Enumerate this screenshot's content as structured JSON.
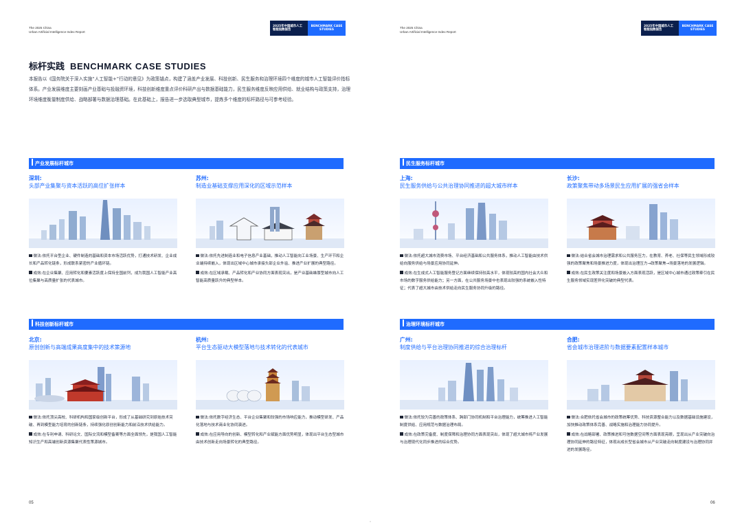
{
  "left_page": {
    "header": {
      "subtitle_line1": "The 2025 China",
      "subtitle_line2": "Urban Artificial Intelligence Index Report",
      "dark_box": "2025年中国城市人工智能指数报告",
      "blue_box": "BENCHMARK CASE STUDIES"
    },
    "title_cn": "标杆实践",
    "title_en": "BENCHMARK CASE STUDIES",
    "intro": "本报告以《国务院关于深入实施“人工智能+”行动的意见》为政策锚点，构建了涵盖产业发展、科技创新、民生服务和治理环境四个维度的城市人工智能评价指标体系。产业发展维度主要刻画产业基础与投融资环境，科技创新维度重点评价科研产出与数据基础能力，民生服务维度反映应用供给、就业结构与政策支持，治理环境维度衡量制度供给、战略部署与数据治理基础。在此基础上，报告进一步选取典型城市，提炼多个维度的标杆路径与可参考经验。",
    "sections": [
      {
        "band": "产业发展标杆城市",
        "cases": [
          {
            "city": "深圳:",
            "slogan": "头部产业集聚与资本活跃的高位扩张样本",
            "method_label": "做法:",
            "method": "依托平台型企业、硬件制造的基础和资本市场活跃优势，打通技术研发、企业成长和产品转化链条，形成联系紧密的产业循环链。",
            "result_label": "成效:",
            "result": "在企业集聚、应用转化和要素活跃度上保持全国前列，成为我国人工智能产业高位集聚与高质量扩张的代表城市。"
          },
          {
            "city": "苏州:",
            "slogan": "制造业基础支撑应用深化的区域示范样本",
            "method_label": "做法:",
            "method": "依托先进制造业和电子信息产业基础，推动人工智能向工业场景、生产环节和企业端持续嵌入，体现出区域中心城市承接头部企业外溢、推进产业扩展的典型路径。",
            "result_label": "成效:",
            "result": "在区域承载、产品转化和产业协同方面表现突出，是产业基础雄厚型城市向人工智能高质量跃升的典型样本。"
          }
        ]
      },
      {
        "band": "科技创新标杆城市",
        "cases": [
          {
            "city": "北京:",
            "slogan": "原创创新与高端成果高度集中的技术策源地",
            "method_label": "做法:",
            "method": "依托顶尖高校、科研机构和国家级创新平台，形成了从基础研究到原始技术突破、再到模型能力培育的创新链条，持续强化原创创新能力和前沿技术供给能力。",
            "result_label": "成效:",
            "result": "在专利申请、科研论文、国际交流和模型备案等方面全面领先，是我国人工智能知识生产和高端创新资源集聚代表性策源城市。"
          },
          {
            "city": "杭州:",
            "slogan": "平台生态驱动大模型落地与技术转化的代表城市",
            "method_label": "做法:",
            "method": "依托数字经济生态、平台企业集聚和较强的市场响应能力，推动模型研发、产品化落地与技术商业化协同演进。",
            "result_label": "成效:",
            "result": "在应用导向的创新、模型转化和产业赋能方面优势明显，体现出平台生态型城市由技术创新走向场景转化的典型路径。"
          }
        ]
      }
    ],
    "page_number": "05"
  },
  "right_page": {
    "header": {
      "subtitle_line1": "The 2025 China",
      "subtitle_line2": "Urban Artificial Intelligence Index Report",
      "dark_box": "2025年中国城市人工智能指数报告",
      "blue_box": "BENCHMARK CASE STUDIES"
    },
    "sections": [
      {
        "band": "民生服务标杆城市",
        "cases": [
          {
            "city": "上海:",
            "slogan": "民生服务供给与公共治理协同推进的超大城市样本",
            "method_label": "做法:",
            "method": "依托超大城市消费市场、平台经济基础和公共服务体系，推动人工智能由技术供给向服务供给与场景应用协同延伸。",
            "result_label": "成效:",
            "result": "在生成式人工智能服务登记方面继续保持较高水平，体现较高的国内社会大众和市场的数字服务供给能力；另一方面，在公共服务场景中也表现出较强的系统嵌入性特征；代表了超大城市由技术供给走向民生服务协同升级的路径。"
          },
          {
            "city": "长沙:",
            "slogan": "政策聚焦带动多场景民生应用扩展的强省会样本",
            "method_label": "做法:",
            "method": "结合省会城市治理需求和公共服务压力，在教育、养老、社保等民生领域形成较强的政策聚焦和场景推进力度，体现出治理压力→政策聚焦→场景落地的发展逻辑。",
            "result_label": "成效:",
            "result": "在民生政策关注度和场景嵌入方面表现活跃，是区域中心城市通过政策牵引在民生服务领域实现差异化突破的典型代表。"
          }
        ]
      },
      {
        "band": "治理环境标杆城市",
        "cases": [
          {
            "city": "广州:",
            "slogan": "制度供给与平台治理协同推进的综合治理标杆",
            "method_label": "做法:",
            "method": "依托较为完善的政策体系、跨部门协同机制和平台治理能力，统筹推进人工智能制度供给、应用规范与数据治理布局。",
            "result_label": "成效:",
            "result": "在政策完备度、制度保障和治理协同方面表现突出，体现了超大城市将产业发展与治理现代化同步推进的综合优势。"
          },
          {
            "city": "合肥:",
            "slogan": "省会城市治理进阶与数据要素配置样本城市",
            "method_label": "做法:",
            "method": "合肥依托省会城市的政策统筹优势、科技资源整合能力以及数据基础设施建设，加快推动政策体系完善、战略实施和治理能力协同提升。",
            "result_label": "成效:",
            "result": "在战略部署、政策推进和可信数据空间等方面表现亮眼，呈现出从产业突破向治理协同延伸的路径特征，体现出成长型省会城市从产业突破走向制度建设与治理协同并进的发展路径。"
          }
        ]
      }
    ],
    "page_number": "06"
  },
  "colors": {
    "brand_blue": "#1f6bff",
    "dark_navy": "#0b1f4d",
    "text": "#1d2433"
  }
}
